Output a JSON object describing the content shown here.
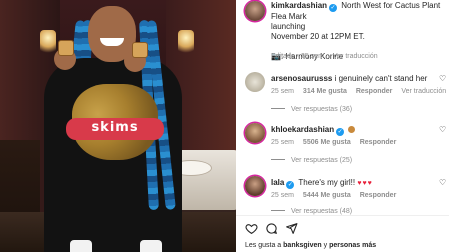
{
  "post": {
    "author": "kimkardashian",
    "caption_lines": [
      "North West for Cactus Plant Flea Mark",
      "launching",
      "November 20 at 12PM ET.",
      "",
      "📷: Harmony Korine"
    ],
    "edited": "Editado · 25 sem",
    "translate": "Ver traducción",
    "sweatshirt_text": "skims"
  },
  "comments": [
    {
      "user": "arsenosaurusss",
      "text": "i genuinely can't stand her",
      "age": "25 sem",
      "likes": "314 Me gusta",
      "reply": "Responder",
      "translate": "Ver traducción",
      "view_replies": "Ver respuestas (36)"
    },
    {
      "user": "khloekardashian",
      "text": "",
      "age": "25 sem",
      "likes": "5506 Me gusta",
      "reply": "Responder",
      "view_replies": "Ver respuestas (25)"
    },
    {
      "user": "lala",
      "text": "There's my girl!!",
      "hearts": "♥♥♥",
      "age": "25 sem",
      "likes": "5444 Me gusta",
      "reply": "Responder",
      "view_replies": "Ver respuestas (48)"
    }
  ],
  "footer": {
    "likes_prefix": "Les gusta a",
    "likes_user": "banksgiven",
    "likes_suffix": "y",
    "likes_others": "personas más"
  },
  "colors": {
    "verified": "#1d9bf0",
    "meta_grey": "#8e8e8e",
    "story_ring": "#d6249f",
    "heart_red": "#e8203a"
  }
}
